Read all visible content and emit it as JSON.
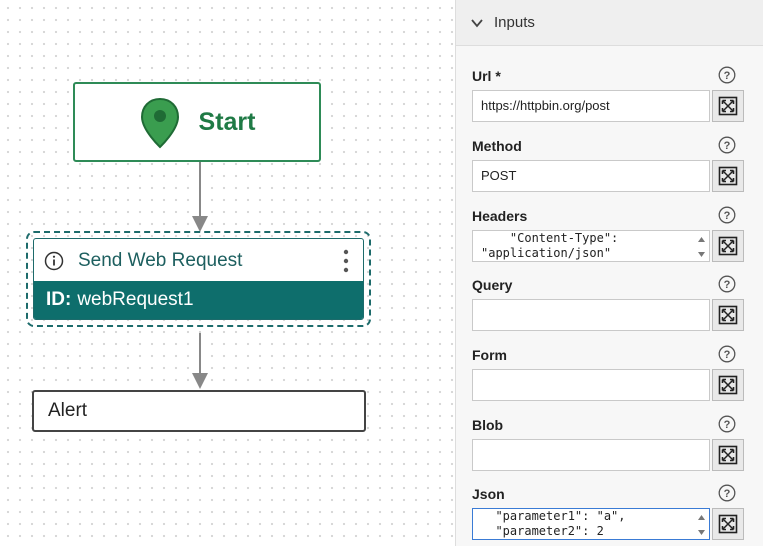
{
  "canvas": {
    "start_node": {
      "label": "Start"
    },
    "web_request_node": {
      "title": "Send Web Request",
      "id_prefix": "ID:",
      "id_value": "webRequest1"
    },
    "alert_node": {
      "label": "Alert"
    }
  },
  "panel": {
    "section_title": "Inputs",
    "fields": {
      "url": {
        "label": "Url *",
        "value": "https://httpbin.org/post"
      },
      "method": {
        "label": "Method",
        "value": "POST"
      },
      "headers": {
        "label": "Headers",
        "line1": "    \"Content-Type\":",
        "line2": "\"application/json\""
      },
      "query": {
        "label": "Query",
        "value": ""
      },
      "form": {
        "label": "Form",
        "value": ""
      },
      "blob": {
        "label": "Blob",
        "value": ""
      },
      "json": {
        "label": "Json",
        "line1": "  \"parameter1\": \"a\",",
        "line2": "  \"parameter2\": 2"
      }
    }
  },
  "colors": {
    "accent": "#0e6e6c",
    "start": "#2e8b57"
  }
}
